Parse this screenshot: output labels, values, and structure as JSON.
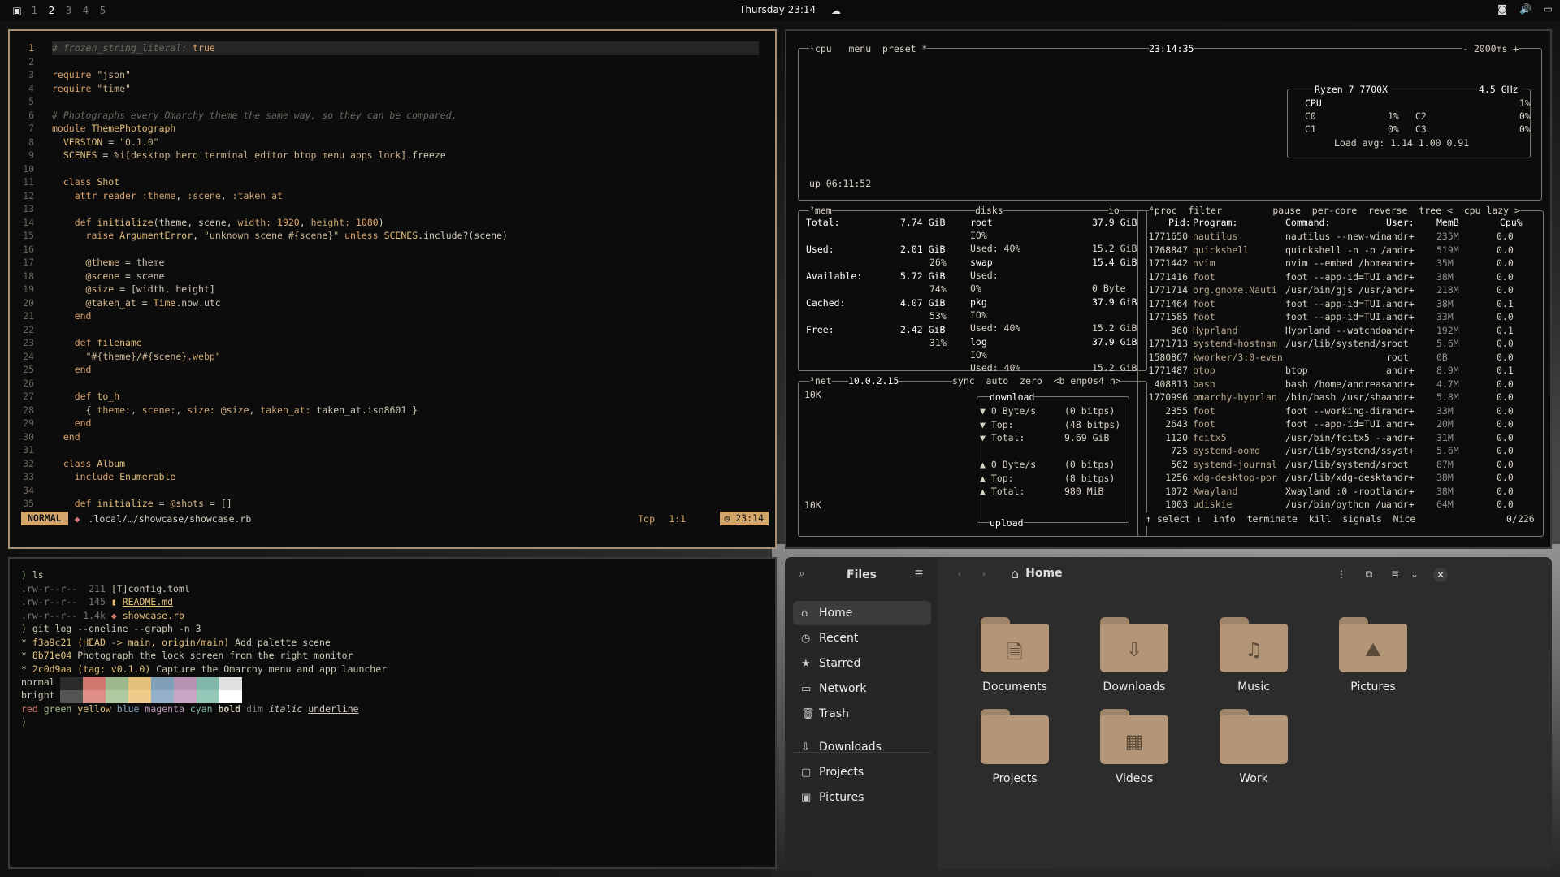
{
  "topbar": {
    "workspaces": [
      "1",
      "2",
      "3",
      "4",
      "5"
    ],
    "active": "2",
    "clock": "Thursday 23:14"
  },
  "editor": {
    "lines": [
      {
        "n": "1",
        "html": "<span class='cm'># frozen_string_literal:</span> <span class='tf'>true</span>"
      },
      {
        "n": "2",
        "html": ""
      },
      {
        "n": "3",
        "html": "<span class='kw'>require</span> <span class='str'>\"json\"</span>"
      },
      {
        "n": "4",
        "html": "<span class='kw'>require</span> <span class='str'>\"time\"</span>"
      },
      {
        "n": "5",
        "html": ""
      },
      {
        "n": "6",
        "html": "<span class='cm'># Photographs every Omarchy theme the same way, so they can be compared.</span>"
      },
      {
        "n": "7",
        "html": "<span class='kw'>module</span> <span class='cls'>ThemePhotograph</span>"
      },
      {
        "n": "8",
        "html": "  <span class='cls'>VERSION</span> = <span class='str'>\"0.1.0\"</span>"
      },
      {
        "n": "9",
        "html": "  <span class='cls'>SCENES</span> = <span class='str'>%i[desktop hero terminal editor btop menu apps lock]</span>.freeze"
      },
      {
        "n": "10",
        "html": ""
      },
      {
        "n": "11",
        "html": "  <span class='kw'>class</span> <span class='cls'>Shot</span>"
      },
      {
        "n": "12",
        "html": "    <span class='kw'>attr_reader</span> <span class='sym'>:theme</span>, <span class='sym'>:scene</span>, <span class='sym'>:taken_at</span>"
      },
      {
        "n": "13",
        "html": ""
      },
      {
        "n": "14",
        "html": "    <span class='kw'>def</span> <span class='cls'>initialize</span>(theme, scene, <span class='sym'>width:</span> <span class='tf'>1920</span>, <span class='sym'>height:</span> <span class='tf'>1080</span>)"
      },
      {
        "n": "15",
        "html": "      <span class='kw'>raise</span> <span class='cls'>ArgumentError</span>, <span class='str'>\"unknown scene #{scene}\"</span> <span class='kw'>unless</span> <span class='cls'>SCENES</span>.include?(scene)"
      },
      {
        "n": "16",
        "html": ""
      },
      {
        "n": "17",
        "html": "      <span class='iv'>@theme</span> = theme"
      },
      {
        "n": "18",
        "html": "      <span class='iv'>@scene</span> = scene"
      },
      {
        "n": "19",
        "html": "      <span class='iv'>@size</span> = [width, height]"
      },
      {
        "n": "20",
        "html": "      <span class='iv'>@taken_at</span> = <span class='cls'>Time</span>.now.utc"
      },
      {
        "n": "21",
        "html": "    <span class='kw'>end</span>"
      },
      {
        "n": "22",
        "html": ""
      },
      {
        "n": "23",
        "html": "    <span class='kw'>def</span> <span class='cls'>filename</span>"
      },
      {
        "n": "24",
        "html": "      <span class='str'>\"#{theme}/#{scene}<span class='sym'>.webp</span>\"</span>"
      },
      {
        "n": "25",
        "html": "    <span class='kw'>end</span>"
      },
      {
        "n": "26",
        "html": ""
      },
      {
        "n": "27",
        "html": "    <span class='kw'>def</span> <span class='cls'>to_h</span>"
      },
      {
        "n": "28",
        "html": "      { <span class='sym'>theme:</span>, <span class='sym'>scene:</span>, <span class='sym'>size:</span> <span class='iv'>@size</span>, <span class='sym'>taken_at:</span> taken_at.iso8601 }"
      },
      {
        "n": "29",
        "html": "    <span class='kw'>end</span>"
      },
      {
        "n": "30",
        "html": "  <span class='kw'>end</span>"
      },
      {
        "n": "31",
        "html": ""
      },
      {
        "n": "32",
        "html": "  <span class='kw'>class</span> <span class='cls'>Album</span>"
      },
      {
        "n": "33",
        "html": "    <span class='kw'>include</span> <span class='cls'>Enumerable</span>"
      },
      {
        "n": "34",
        "html": ""
      },
      {
        "n": "35",
        "html": "    <span class='kw'>def</span> <span class='cls'>initialize</span> = <span class='iv'>@shots</span> = []"
      }
    ],
    "status": {
      "mode": "NORMAL",
      "path": ".local/…/showcase/showcase.rb",
      "top": "Top",
      "pos": "1:1",
      "time": "23:14"
    }
  },
  "btop": {
    "cpu_header": "¹cpu   menu  preset *",
    "clock": "23:14:35",
    "interval": "- 2000ms +",
    "uptime": "up 06:11:52",
    "cpu_name": "Ryzen 7 7700X",
    "freq": "4.5 GHz",
    "cpu_rows": [
      {
        "label": "CPU",
        "val": "1%"
      },
      {
        "label": "C0",
        "val": "1%",
        "label2": "C2",
        "val2": "0%"
      },
      {
        "label": "C1",
        "val": "0%",
        "label2": "C3",
        "val2": "0%"
      }
    ],
    "load": "Load avg: 1.14 1.00 0.91",
    "mem_title": "²mem",
    "mem": [
      {
        "k": "Total:",
        "v": "7.74 GiB"
      },
      {
        "k": "Used:",
        "v": "2.01 GiB",
        "p": "26%"
      },
      {
        "k": "Available:",
        "v": "5.72 GiB",
        "p": "74%"
      },
      {
        "k": "Cached:",
        "v": "4.07 GiB",
        "p": "53%"
      },
      {
        "k": "Free:",
        "v": "2.42 GiB",
        "p": "31%"
      }
    ],
    "disks_title": "disks",
    "io_title": "io",
    "disks": [
      {
        "name": "root",
        "size": "37.9 GiB",
        "io": "IO%",
        "used": "Used: 40%",
        "usedv": "15.2 GiB"
      },
      {
        "name": "swap",
        "size": "15.4 GiB",
        "io": "Used:",
        "used": "0%",
        "usedv": "0 Byte"
      },
      {
        "name": "pkg",
        "size": "37.9 GiB",
        "io": "IO%",
        "used": "Used: 40%",
        "usedv": "15.2 GiB"
      },
      {
        "name": "log",
        "size": "37.9 GiB",
        "io": "IO%",
        "used": "Used: 40%",
        "usedv": "15.2 GiB"
      }
    ],
    "net_title": "³net",
    "net_ip": "10.0.2.15",
    "net_opts": "sync  auto  zero  <b enp0s4 n>",
    "net_scale_top": "10K",
    "net_scale_bot": "10K",
    "download_label": "download",
    "upload_label": "upload",
    "net_rows": [
      {
        "a": "▼ 0 Byte/s",
        "b": "(0 bitps)"
      },
      {
        "a": "▼ Top:",
        "b": "(48 bitps)"
      },
      {
        "a": "▼ Total:",
        "b": "9.69 GiB"
      },
      {
        "a": "",
        "b": ""
      },
      {
        "a": "▲ 0 Byte/s",
        "b": "(0 bitps)"
      },
      {
        "a": "▲ Top:",
        "b": "(8 bitps)"
      },
      {
        "a": "▲ Total:",
        "b": "980 MiB"
      }
    ],
    "proc_title": "⁴proc  filter         pause  per-core  reverse  tree <  cpu lazy >",
    "proc_head": {
      "pid": "Pid:",
      "prog": "Program:",
      "cmd": "Command:",
      "user": "User:",
      "mem": "MemB",
      "cpu": "Cpu%"
    },
    "procs": [
      {
        "pid": "1771650",
        "prog": "nautilus",
        "cmd": "nautilus --new-win",
        "user": "andr+",
        "mem": "235M",
        "cpu": "0.0"
      },
      {
        "pid": "1768847",
        "prog": "quickshell",
        "cmd": "quickshell -n -p /",
        "user": "andr+",
        "mem": "519M",
        "cpu": "0.0"
      },
      {
        "pid": "1771442",
        "prog": "nvim",
        "cmd": "nvim --embed /home",
        "user": "andr+",
        "mem": "35M",
        "cpu": "0.0"
      },
      {
        "pid": "1771416",
        "prog": "foot",
        "cmd": "foot --app-id=TUI.",
        "user": "andr+",
        "mem": "38M",
        "cpu": "0.0"
      },
      {
        "pid": "1771714",
        "prog": "org.gnome.Nauti",
        "cmd": "/usr/bin/gjs /usr/",
        "user": "andr+",
        "mem": "218M",
        "cpu": "0.0"
      },
      {
        "pid": "1771464",
        "prog": "foot",
        "cmd": "foot --app-id=TUI.",
        "user": "andr+",
        "mem": "38M",
        "cpu": "0.1"
      },
      {
        "pid": "1771585",
        "prog": "foot",
        "cmd": "foot --app-id=TUI.",
        "user": "andr+",
        "mem": "33M",
        "cpu": "0.0"
      },
      {
        "pid": "960",
        "prog": "Hyprland",
        "cmd": "Hyprland --watchdo",
        "user": "andr+",
        "mem": "192M",
        "cpu": "0.1"
      },
      {
        "pid": "1771713",
        "prog": "systemd-hostnam",
        "cmd": "/usr/lib/systemd/s",
        "user": "root",
        "mem": "5.6M",
        "cpu": "0.0"
      },
      {
        "pid": "1580867",
        "prog": "kworker/3:0-even",
        "cmd": "",
        "user": "root",
        "mem": "0B",
        "cpu": "0.0"
      },
      {
        "pid": "1771487",
        "prog": "btop",
        "cmd": "btop",
        "user": "andr+",
        "mem": "8.9M",
        "cpu": "0.1"
      },
      {
        "pid": "408813",
        "prog": "bash",
        "cmd": "bash /home/andreas",
        "user": "andr+",
        "mem": "4.7M",
        "cpu": "0.0"
      },
      {
        "pid": "1770996",
        "prog": "omarchy-hyprlan",
        "cmd": "/bin/bash /usr/sha",
        "user": "andr+",
        "mem": "5.8M",
        "cpu": "0.0"
      },
      {
        "pid": "2355",
        "prog": "foot",
        "cmd": "foot --working-dir",
        "user": "andr+",
        "mem": "33M",
        "cpu": "0.0"
      },
      {
        "pid": "2643",
        "prog": "foot",
        "cmd": "foot --app-id=TUI.",
        "user": "andr+",
        "mem": "20M",
        "cpu": "0.0"
      },
      {
        "pid": "1120",
        "prog": "fcitx5",
        "cmd": "/usr/bin/fcitx5 --",
        "user": "andr+",
        "mem": "31M",
        "cpu": "0.0"
      },
      {
        "pid": "725",
        "prog": "systemd-oomd",
        "cmd": "/usr/lib/systemd/s",
        "user": "syst+",
        "mem": "5.6M",
        "cpu": "0.0"
      },
      {
        "pid": "562",
        "prog": "systemd-journal",
        "cmd": "/usr/lib/systemd/s",
        "user": "root",
        "mem": "87M",
        "cpu": "0.0"
      },
      {
        "pid": "1256",
        "prog": "xdg-desktop-por",
        "cmd": "/usr/lib/xdg-deskt",
        "user": "andr+",
        "mem": "38M",
        "cpu": "0.0"
      },
      {
        "pid": "1072",
        "prog": "Xwayland",
        "cmd": "Xwayland :0 -rootl",
        "user": "andr+",
        "mem": "38M",
        "cpu": "0.0"
      },
      {
        "pid": "1003",
        "prog": "udiskie",
        "cmd": "/usr/bin/python /u",
        "user": "andr+",
        "mem": "64M",
        "cpu": "0.0"
      }
    ],
    "proc_footer": "↑ select ↓  info  terminate  kill  signals  Nice",
    "proc_count": "0/226"
  },
  "term": {
    "lines": [
      "<span class='g'>)</span> ls",
      "<span class='gr'>.rw-r--r--</span>  <span class='gr'>211</span> <span>[T]</span>config.toml",
      "<span class='gr'>.rw-r--r--</span>  <span class='gr'>145</span> <span class='y'>▮ <u>README.md</u></span>",
      "<span class='gr'>.rw-r--r--</span> <span class='gr'>1.4k</span> <span class='r'>◆</span> <span class='y'>showcase.rb</span>",
      "<span class='g'>)</span> git log --oneline --graph -n 3",
      "* <span class='y'>f3a9c21</span> <span class='y'>(HEAD -> main, origin/main)</span> Add palette scene",
      "* <span class='y'>8b71e04</span> Photograph the lock screen from the right monitor",
      "* <span class='y'>2c0d9aa</span> <span class='y'>(tag: v0.1.0)</span> Capture the Omarchy menu and app launcher"
    ],
    "palette_normal": "normal",
    "palette_bright": "bright",
    "colors_line": "<span class='r'>red</span> <span class='g'>green</span> <span class='y'>yellow</span> <span class='b'>blue</span> <span class='m'>magenta</span> <span class='c'>cyan</span> <b>bold</b> <span class='gr'>dim</span> <i>italic</i> <u>underline</u>",
    "prompt": ")"
  },
  "files": {
    "title": "Files",
    "location": "Home",
    "sidebar": [
      {
        "label": "Home",
        "icon": "⌂"
      },
      {
        "label": "Recent",
        "icon": "◷"
      },
      {
        "label": "Starred",
        "icon": "★"
      },
      {
        "label": "Network",
        "icon": "▭"
      },
      {
        "label": "Trash",
        "icon": "🗑"
      },
      {
        "label": "Downloads",
        "icon": "⇩"
      },
      {
        "label": "Projects",
        "icon": "▢"
      },
      {
        "label": "Pictures",
        "icon": "▣"
      }
    ],
    "folders": [
      {
        "label": "Documents",
        "glyph": "🗎"
      },
      {
        "label": "Downloads",
        "glyph": "⇩"
      },
      {
        "label": "Music",
        "glyph": "♫"
      },
      {
        "label": "Pictures",
        "glyph": "⛰"
      },
      {
        "label": "Projects",
        "glyph": ""
      },
      {
        "label": "Videos",
        "glyph": "▦"
      },
      {
        "label": "Work",
        "glyph": ""
      }
    ]
  },
  "colors": {
    "accent": "#d3a56b",
    "palette_normal": [
      "#2b2b2b",
      "#d07870",
      "#9db88a",
      "#e2c07a",
      "#7f9fb8",
      "#b892b5",
      "#7fb8a8",
      "#e0e0e0"
    ],
    "palette_bright": [
      "#555555",
      "#e08f86",
      "#b0c9a0",
      "#edcc8c",
      "#95b0c8",
      "#c9a6c6",
      "#95c8b9",
      "#ffffff"
    ]
  }
}
